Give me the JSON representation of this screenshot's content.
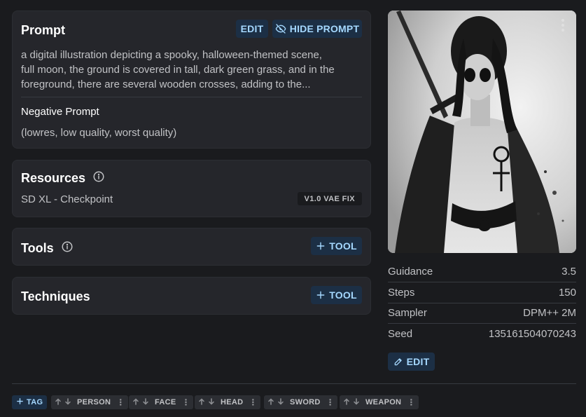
{
  "prompt": {
    "title": "Prompt",
    "edit_label": "EDIT",
    "hide_label": "HIDE PROMPT",
    "text_lines": [
      "a digital illustration depicting a spooky, halloween-themed scene,",
      "full moon, the ground is covered in tall, dark green grass, and in the",
      "foreground, there are several wooden crosses, adding to the..."
    ],
    "negative_title": "Negative Prompt",
    "negative_text": "(lowres, low quality, worst quality)"
  },
  "resources": {
    "title": "Resources",
    "item_name": "SD XL - Checkpoint",
    "item_badge": "V1.0 VAE FIX"
  },
  "tools": {
    "title": "Tools",
    "add_label": "TOOL"
  },
  "techniques": {
    "title": "Techniques",
    "add_label": "TOOL"
  },
  "params": [
    {
      "label": "Guidance",
      "value": "3.5"
    },
    {
      "label": "Steps",
      "value": "150"
    },
    {
      "label": "Sampler",
      "value": "DPM++ 2M"
    },
    {
      "label": "Seed",
      "value": "135161504070243"
    }
  ],
  "params_edit_label": "EDIT",
  "tags": {
    "add_label": "TAG",
    "items": [
      "PERSON",
      "FACE",
      "HEAD",
      "SWORD",
      "WEAPON"
    ]
  },
  "icons": {
    "image_menu": "vertical-dots-icon",
    "hide": "eye-off-icon",
    "info": "info-circle-icon",
    "plus": "plus-icon",
    "pencil": "pencil-icon",
    "vote_up": "arrow-up-icon",
    "vote_down": "arrow-down-icon"
  },
  "colors": {
    "background": "#1a1b1e",
    "card": "#25262b",
    "accent_bg": "#1c2f45",
    "accent_text": "#a5d8ff"
  }
}
